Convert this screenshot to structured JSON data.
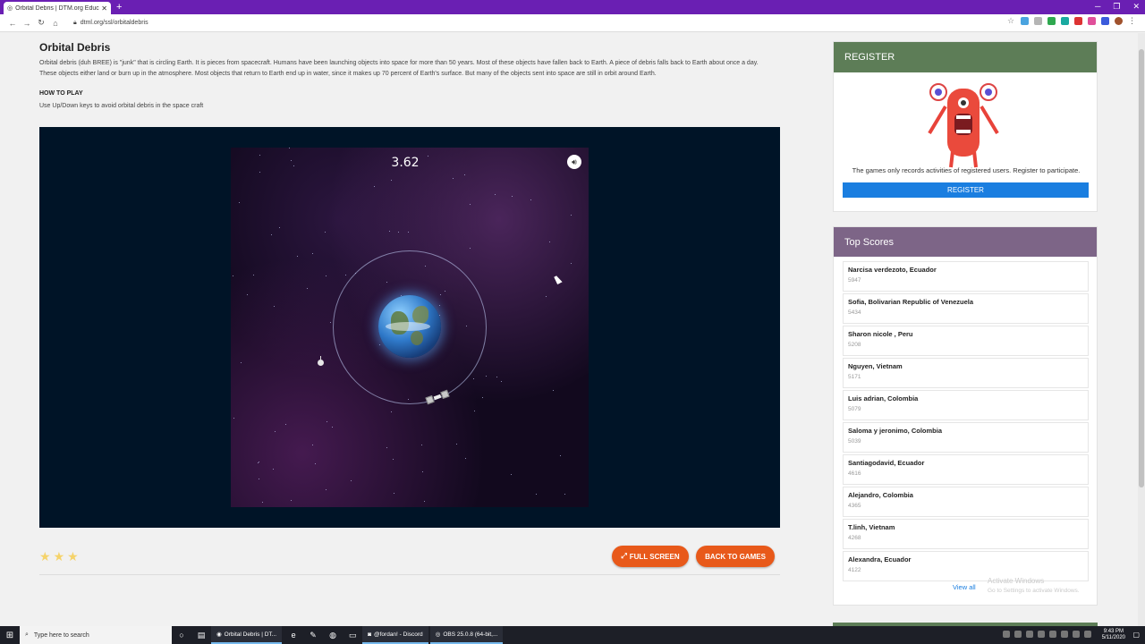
{
  "browser": {
    "tab_title": "Orbital Debris | DTM.org Educa",
    "url": "dtml.org/ssl/orbitaldebris"
  },
  "page": {
    "title": "Orbital Debris",
    "description": "Orbital debris (duh BREE) is \"junk\" that is circling Earth. It is pieces from spacecraft. Humans have been launching objects into space for more than 50 years. Most of these objects have fallen back to Earth. A piece of debris falls back to Earth about once a day. These objects either land or burn up in the atmosphere. Most objects that return to Earth end up in water, since it makes up 70 percent of Earth's surface. But many of the objects sent into space are still in orbit around Earth.",
    "how_to_play_heading": "HOW TO PLAY",
    "how_to_play_text": "Use Up/Down keys to avoid orbital debris in the space craft"
  },
  "game": {
    "score": "3.62"
  },
  "rating": {
    "stars": 3,
    "max": 3
  },
  "buttons": {
    "full_screen": "FULL SCREEN",
    "back_to_games": "BACK TO GAMES"
  },
  "register": {
    "heading": "REGISTER",
    "text": "The games only records activities of registered users. Register to participate.",
    "button": "REGISTER"
  },
  "top_scores": {
    "heading": "Top Scores",
    "entries": [
      {
        "name": "Narcisa verdezoto, Ecuador",
        "score": "5947"
      },
      {
        "name": "Sofia, Bolivarian Republic of Venezuela",
        "score": "5434"
      },
      {
        "name": "Sharon nicole , Peru",
        "score": "5208"
      },
      {
        "name": "Nguyen, Vietnam",
        "score": "5171"
      },
      {
        "name": "Luis adrian, Colombia",
        "score": "5079"
      },
      {
        "name": "Saloma y jeronimo, Colombia",
        "score": "5039"
      },
      {
        "name": "Santiagodavid, Ecuador",
        "score": "4616"
      },
      {
        "name": "Alejandro, Colombia",
        "score": "4365"
      },
      {
        "name": "T.linh, Vietnam",
        "score": "4268"
      },
      {
        "name": "Alexandra, Ecuador",
        "score": "4122"
      }
    ],
    "view_all": "View all"
  },
  "watermark": {
    "title": "Activate Windows",
    "subtitle": "Go to Settings to activate Windows."
  },
  "taskbar": {
    "search_placeholder": "Type here to search",
    "apps": [
      "Orbital Debris | DT...",
      "@fordan! - Discord",
      "OBS 25.0.8 (64-bit,..."
    ],
    "time": "9:43 PM",
    "date": "5/11/2020"
  }
}
